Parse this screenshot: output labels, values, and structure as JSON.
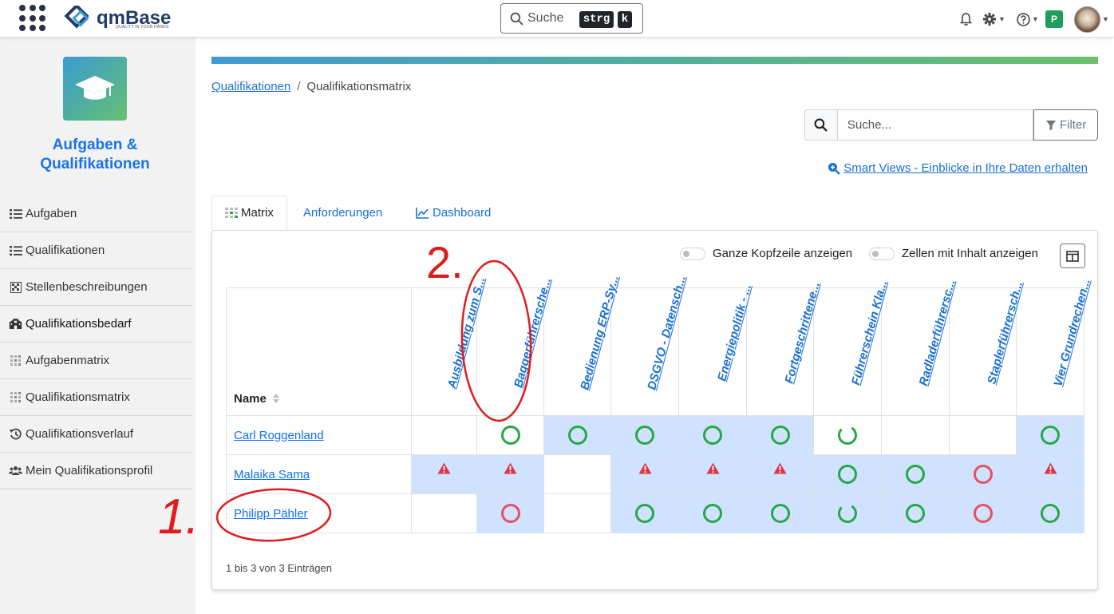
{
  "app": {
    "brand": "qmBase",
    "tagline": "QUALITY IN YOUR HANDS",
    "search_label": "Suche",
    "shortcut_1": "strg",
    "shortcut_2": "k",
    "user_badge": "P"
  },
  "sidebar": {
    "title": "Aufgaben & Qualifikationen",
    "items": [
      {
        "label": "Aufgaben",
        "icon": "list-icon"
      },
      {
        "label": "Qualifikationen",
        "icon": "list-icon"
      },
      {
        "label": "Stellenbeschreibungen",
        "icon": "grid-icon"
      },
      {
        "label": "Qualifikationsbedarf",
        "icon": "building-icon"
      },
      {
        "label": "Aufgabenmatrix",
        "icon": "matrix-icon"
      },
      {
        "label": "Qualifikationsmatrix",
        "icon": "matrix-icon"
      },
      {
        "label": "Qualifikationsverlauf",
        "icon": "history-icon"
      },
      {
        "label": "Mein Qualifikationsprofil",
        "icon": "users-icon"
      }
    ]
  },
  "breadcrumb": {
    "parent": "Qualifikationen",
    "separator": "/",
    "current": "Qualifikationsmatrix"
  },
  "search": {
    "placeholder": "Suche...",
    "filter_label": "Filter"
  },
  "smart_views": "Smart Views - Einblicke in Ihre Daten erhalten",
  "tabs": [
    {
      "label": "Matrix",
      "active": true
    },
    {
      "label": "Anforderungen",
      "active": false
    },
    {
      "label": "Dashboard",
      "active": false
    }
  ],
  "toggles": {
    "header": "Ganze Kopfzeile anzeigen",
    "cells": "Zellen mit Inhalt anzeigen"
  },
  "matrix": {
    "name_header": "Name",
    "columns": [
      "Ausbildung zum S...",
      "Baggerführersche...",
      "Bedienung ERP-Sy...",
      "DSGVO - Datensch...",
      "Energiepolitik - ...",
      "Fortgeschrittene...",
      "Führerschein Kla...",
      "Radladerführersc...",
      "Staplerführersch...",
      "Vier Grundrechen..."
    ],
    "rows": [
      {
        "name": "Carl Roggenland",
        "cells": [
          {
            "s": "empty",
            "bg": false
          },
          {
            "s": "ok",
            "bg": false
          },
          {
            "s": "ok",
            "bg": true
          },
          {
            "s": "ok",
            "bg": true
          },
          {
            "s": "ok",
            "bg": true
          },
          {
            "s": "ok",
            "bg": true
          },
          {
            "s": "partial",
            "bg": false
          },
          {
            "s": "empty",
            "bg": false
          },
          {
            "s": "empty",
            "bg": false
          },
          {
            "s": "ok",
            "bg": true
          }
        ]
      },
      {
        "name": "Malaika Sama",
        "cells": [
          {
            "s": "warn",
            "bg": true
          },
          {
            "s": "warn",
            "bg": true
          },
          {
            "s": "empty",
            "bg": false
          },
          {
            "s": "warn",
            "bg": true
          },
          {
            "s": "warn",
            "bg": true
          },
          {
            "s": "warn",
            "bg": true
          },
          {
            "s": "ok",
            "bg": true
          },
          {
            "s": "ok",
            "bg": true
          },
          {
            "s": "missing",
            "bg": true
          },
          {
            "s": "warn",
            "bg": true
          }
        ]
      },
      {
        "name": "Philipp Pähler",
        "cells": [
          {
            "s": "empty",
            "bg": false
          },
          {
            "s": "missing",
            "bg": true
          },
          {
            "s": "empty",
            "bg": false
          },
          {
            "s": "ok",
            "bg": true
          },
          {
            "s": "ok",
            "bg": true
          },
          {
            "s": "ok",
            "bg": true
          },
          {
            "s": "partial",
            "bg": true
          },
          {
            "s": "ok",
            "bg": true
          },
          {
            "s": "missing",
            "bg": true
          },
          {
            "s": "ok",
            "bg": true
          }
        ]
      }
    ],
    "entries_info": "1 bis 3 von 3 Einträgen"
  },
  "annotations": [
    "1.",
    "2."
  ],
  "colors": {
    "ok": "#28a745",
    "missing": "#e8505b",
    "warn": "#dc3545",
    "cell_bg": "#cfe2ff",
    "annotation": "#e01b1b"
  }
}
